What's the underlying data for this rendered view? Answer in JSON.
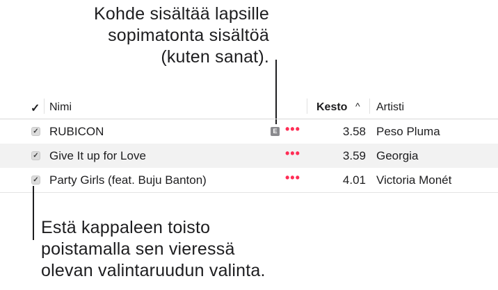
{
  "callouts": {
    "explicit": "Kohde sisältää lapsille\nsopimatonta sisältöä\n(kuten sanat).",
    "checkbox": "Estä kappaleen toisto\npoistamalla sen vieressä\nolevan valintaruudun valinta."
  },
  "header": {
    "check": "✓",
    "name": "Nimi",
    "time": "Kesto",
    "sort_indicator": "^",
    "artist": "Artisti"
  },
  "icons": {
    "explicit_badge": "E",
    "more": "•••",
    "checkmark": "✓"
  },
  "rows": [
    {
      "name": "RUBICON",
      "explicit": true,
      "time": "3.58",
      "artist": "Peso Pluma",
      "checked": true
    },
    {
      "name": "Give It up for Love",
      "explicit": false,
      "time": "3.59",
      "artist": "Georgia",
      "checked": true
    },
    {
      "name": "Party Girls (feat. Buju Banton)",
      "explicit": false,
      "time": "4.01",
      "artist": "Victoria Monét",
      "checked": true
    }
  ],
  "colors": {
    "more_button": "#ff2d55",
    "alt_row": "#f2f2f2",
    "badge": "#8a8a8e"
  }
}
